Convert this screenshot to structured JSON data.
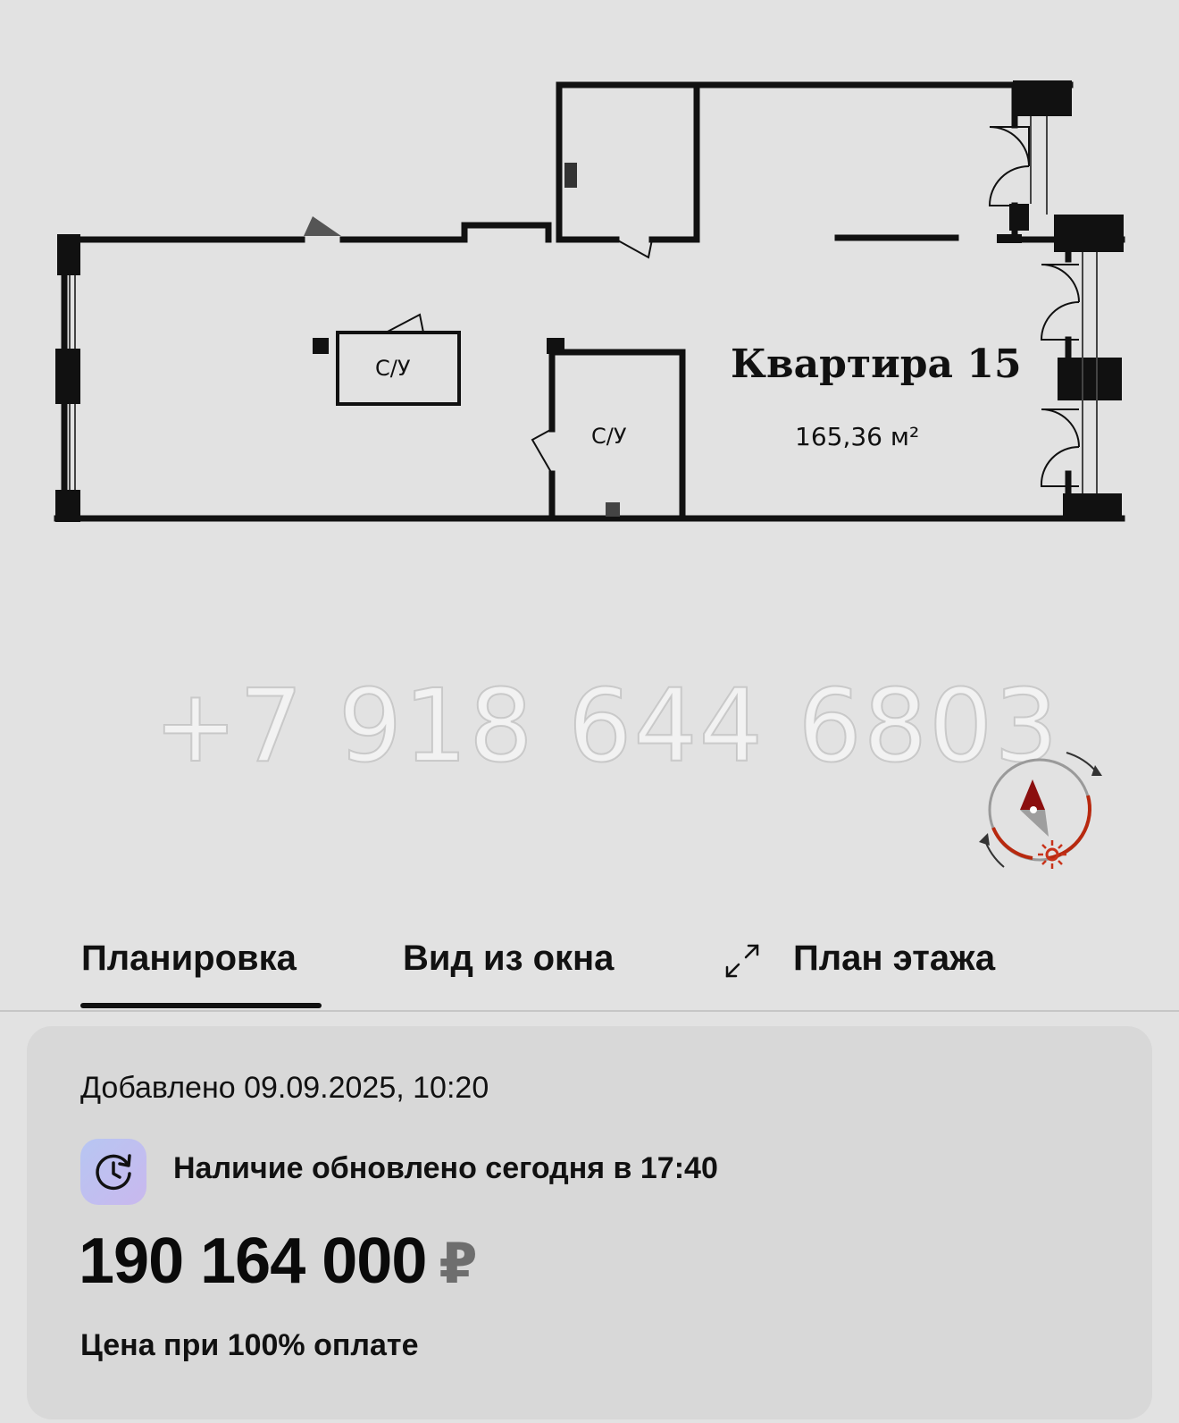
{
  "plan": {
    "title": "Квартира 15",
    "area": "165,36 м²",
    "rooms": [
      "С/У",
      "С/У"
    ]
  },
  "watermark": "+7 918 644 6803",
  "compass": {
    "icon": "compass-icon",
    "accent": "#b8290f"
  },
  "tabs": [
    {
      "label": "Планировка",
      "active": true
    },
    {
      "label": "Вид из окна",
      "active": false
    },
    {
      "label": "План этажа",
      "active": false,
      "icon": "expand-icon"
    }
  ],
  "card": {
    "added": "Добавлено 09.09.2025, 10:20",
    "availability": "Наличие обновлено сегодня в 17:40",
    "availability_icon": "clock-refresh-icon",
    "price": "190 164 000",
    "currency": "₽",
    "price_note": "Цена при 100% оплате"
  },
  "colors": {
    "background": "#e2e2e2",
    "card": "#d8d8d8",
    "text": "#111111",
    "currency": "#6e6e6e"
  }
}
